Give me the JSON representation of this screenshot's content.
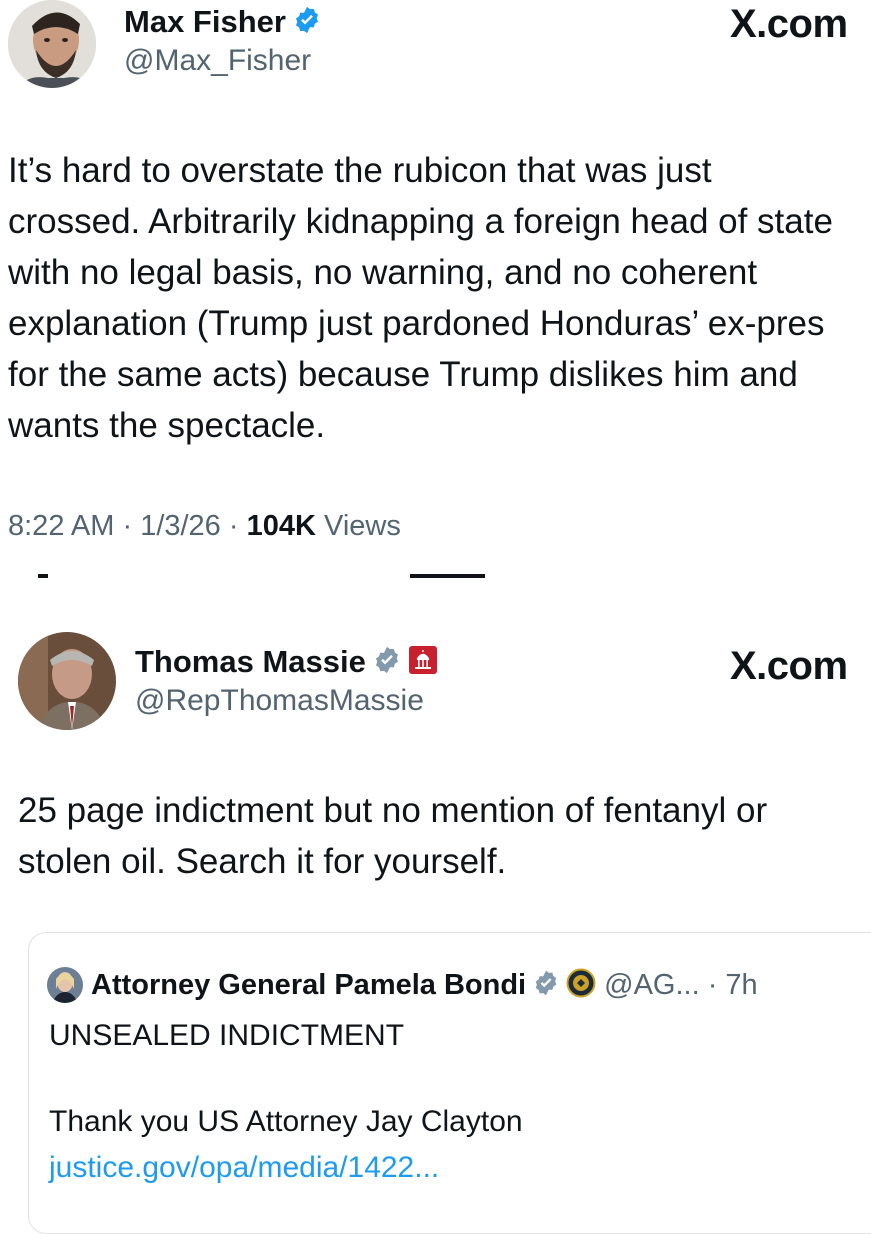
{
  "tweet1": {
    "author_name": "Max Fisher",
    "author_handle": "@Max_Fisher",
    "brand": "X.com",
    "verified_icon": "verified-badge-icon",
    "body": "It’s hard to overstate the rubicon that was just crossed. Arbitrarily kidnapping a foreign head of state with no legal basis, no warning, and no coherent explanation (Trump just pardoned Honduras’ ex-pres for the same acts) because Trump dislikes him and wants the spectacle.",
    "time": "8:22 AM",
    "date": "1/3/26",
    "views_count": "104K",
    "views_label": "Views"
  },
  "tweet2": {
    "author_name": "Thomas Massie",
    "author_handle": "@RepThomasMassie",
    "brand": "X.com",
    "verified_icon": "verified-badge-gray-icon",
    "affiliation_icon": "capitol-building-icon",
    "body": "25 page indictment but no mention of fentanyl or stolen oil. Search it for yourself."
  },
  "quoted": {
    "author_name": "Attorney General Pamela Bondi",
    "author_handle": "@AG...",
    "time": "7h",
    "verified_icon": "verified-badge-gray-icon",
    "affiliation_icon": "doj-seal-icon",
    "line1": "UNSEALED INDICTMENT",
    "line2": "Thank you US Attorney Jay Clayton",
    "link": "justice.gov/opa/media/1422..."
  },
  "colors": {
    "text": "#0f1419",
    "secondary": "#536471",
    "verified_blue": "#1d9bf0",
    "verified_gray": "#829aab",
    "link": "#1d9bf0",
    "affiliation_red": "#c8202f"
  }
}
